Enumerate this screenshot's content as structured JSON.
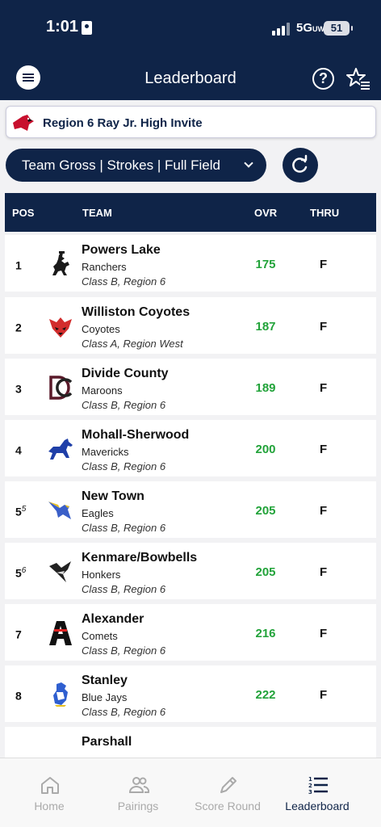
{
  "status": {
    "time": "1:01",
    "network": "5G",
    "network_sup": "UW",
    "battery": "51"
  },
  "header": {
    "title": "Leaderboard"
  },
  "event": {
    "name": "Region 6 Ray Jr. High Invite"
  },
  "filter": {
    "label": "Team Gross | Strokes | Full Field"
  },
  "table": {
    "headers": {
      "pos": "POS",
      "team": "TEAM",
      "ovr": "OVR",
      "thru": "THRU"
    },
    "rows": [
      {
        "pos": "1",
        "pos_sup": "",
        "team": "Powers Lake",
        "mascot": "Ranchers",
        "region": "Class B, Region 6",
        "ovr": "175",
        "thru": "F",
        "logo": "bronco-rider-icon"
      },
      {
        "pos": "2",
        "pos_sup": "",
        "team": "Williston Coyotes",
        "mascot": "Coyotes",
        "region": "Class A, Region West",
        "ovr": "187",
        "thru": "F",
        "logo": "coyote-icon"
      },
      {
        "pos": "3",
        "pos_sup": "",
        "team": "Divide County",
        "mascot": "Maroons",
        "region": "Class B, Region 6",
        "ovr": "189",
        "thru": "F",
        "logo": "dc-monogram-icon"
      },
      {
        "pos": "4",
        "pos_sup": "",
        "team": "Mohall-Sherwood",
        "mascot": "Mavericks",
        "region": "Class B, Region 6",
        "ovr": "200",
        "thru": "F",
        "logo": "horse-icon"
      },
      {
        "pos": "5",
        "pos_sup": "5",
        "team": "New Town",
        "mascot": "Eagles",
        "region": "Class B, Region 6",
        "ovr": "205",
        "thru": "F",
        "logo": "eagle-icon"
      },
      {
        "pos": "5",
        "pos_sup": "6",
        "team": "Kenmare/Bowbells",
        "mascot": "Honkers",
        "region": "Class B, Region 6",
        "ovr": "205",
        "thru": "F",
        "logo": "goose-icon"
      },
      {
        "pos": "7",
        "pos_sup": "",
        "team": "Alexander",
        "mascot": "Comets",
        "region": "Class B, Region 6",
        "ovr": "216",
        "thru": "F",
        "logo": "letter-a-icon"
      },
      {
        "pos": "8",
        "pos_sup": "",
        "team": "Stanley",
        "mascot": "Blue Jays",
        "region": "Class B, Region 6",
        "ovr": "222",
        "thru": "F",
        "logo": "blue-jay-icon"
      },
      {
        "pos": "",
        "pos_sup": "",
        "team": "Parshall",
        "mascot": "",
        "region": "",
        "ovr": "",
        "thru": "",
        "logo": "parshall-icon"
      }
    ]
  },
  "nav": [
    {
      "label": "Home",
      "icon": "home-icon"
    },
    {
      "label": "Pairings",
      "icon": "pairings-icon"
    },
    {
      "label": "Score Round",
      "icon": "pencil-icon"
    },
    {
      "label": "Leaderboard",
      "icon": "leaderboard-icon"
    }
  ],
  "colors": {
    "navy": "#0f2448",
    "green": "#22a33a",
    "background": "#f2f2f4"
  }
}
